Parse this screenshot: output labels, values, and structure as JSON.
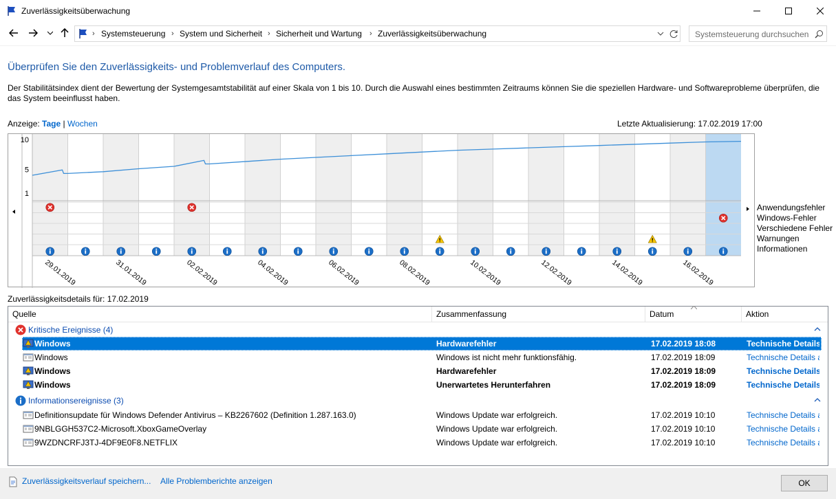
{
  "window": {
    "title": "Zuverlässigkeitsüberwachung"
  },
  "address": {
    "crumbs": [
      "Systemsteuerung",
      "System und Sicherheit",
      "Sicherheit und Wartung",
      "Zuverlässigkeitsüberwachung"
    ],
    "search_placeholder": "Systemsteuerung durchsuchen"
  },
  "page": {
    "heading": "Überprüfen Sie den Zuverlässigkeits- und Problemverlauf des Computers.",
    "description": "Der Stabilitätsindex dient der Bewertung der Systemgesamtstabilität auf einer Skala von 1 bis 10. Durch die Auswahl eines bestimmten Zeitraums können Sie die speziellen Hardware- und Softwareprobleme überprüfen, die das System beeinflusst haben.",
    "view_label": "Anzeige:",
    "view_days": "Tage",
    "view_sep": "|",
    "view_weeks": "Wochen",
    "last_update": "Letzte Aktualisierung: 17.02.2019 17:00"
  },
  "chart": {
    "y_ticks": [
      "10",
      "5",
      "1"
    ],
    "legend": [
      "Anwendungsfehler",
      "Windows-Fehler",
      "Verschiedene Fehler",
      "Warnungen",
      "Informationen"
    ],
    "dates": [
      "29.01.2019",
      "31.01.2019",
      "02.02.2019",
      "04.02.2019",
      "06.02.2019",
      "08.02.2019",
      "10.02.2019",
      "12.02.2019",
      "14.02.2019",
      "16.02.2019"
    ],
    "selected_day": "17.02.2019"
  },
  "chart_data": {
    "type": "line",
    "x": [
      "29.01.2019",
      "30.01.2019",
      "31.01.2019",
      "01.02.2019",
      "02.02.2019",
      "03.02.2019",
      "04.02.2019",
      "05.02.2019",
      "06.02.2019",
      "07.02.2019",
      "08.02.2019",
      "09.02.2019",
      "10.02.2019",
      "11.02.2019",
      "12.02.2019",
      "13.02.2019",
      "14.02.2019",
      "15.02.2019",
      "16.02.2019",
      "17.02.2019"
    ],
    "stability_index": [
      4.0,
      4.3,
      4.6,
      5.1,
      5.5,
      5.9,
      6.3,
      6.7,
      7.0,
      7.3,
      7.6,
      7.9,
      8.2,
      8.4,
      8.6,
      8.8,
      9.0,
      9.2,
      9.4,
      9.6
    ],
    "y_ticks": [
      10,
      5,
      1
    ],
    "events": {
      "Anwendungsfehler": [
        "29.01.2019",
        "02.02.2019"
      ],
      "Windows-Fehler": [
        "17.02.2019"
      ],
      "Verschiedene Fehler": [],
      "Warnungen": [
        "09.02.2019",
        "15.02.2019"
      ],
      "Informationen": [
        "29.01.2019",
        "30.01.2019",
        "31.01.2019",
        "01.02.2019",
        "02.02.2019",
        "03.02.2019",
        "04.02.2019",
        "05.02.2019",
        "06.02.2019",
        "07.02.2019",
        "08.02.2019",
        "09.02.2019",
        "10.02.2019",
        "11.02.2019",
        "12.02.2019",
        "13.02.2019",
        "14.02.2019",
        "15.02.2019",
        "16.02.2019",
        "17.02.2019"
      ]
    },
    "selected": "17.02.2019"
  },
  "details": {
    "label": "Zuverlässigkeitsdetails für: 17.02.2019",
    "columns": [
      "Quelle",
      "Zusammenfassung",
      "Datum",
      "Aktion"
    ],
    "groups": [
      {
        "label": "Kritische Ereignisse (4)",
        "rows": [
          {
            "source": "Windows",
            "summary": "Hardwarefehler",
            "date": "17.02.2019 18:08",
            "action": "Technische Details anzeigen"
          },
          {
            "source": "Windows",
            "summary": "Windows ist nicht mehr funktionsfähig.",
            "date": "17.02.2019 18:09",
            "action": "Technische Details anzeigen"
          },
          {
            "source": "Windows",
            "summary": "Hardwarefehler",
            "date": "17.02.2019 18:09",
            "action": "Technische Details anzeigen"
          },
          {
            "source": "Windows",
            "summary": "Unerwartetes Herunterfahren",
            "date": "17.02.2019 18:09",
            "action": "Technische Details anzeigen"
          }
        ]
      },
      {
        "label": "Informationsereignisse (3)",
        "rows": [
          {
            "source": "Definitionsupdate für Windows Defender Antivirus – KB2267602 (Definition 1.287.163.0)",
            "summary": "Windows Update war erfolgreich.",
            "date": "17.02.2019 10:10",
            "action": "Technische Details anzeigen"
          },
          {
            "source": "9NBLGGH537C2-Microsoft.XboxGameOverlay",
            "summary": "Windows Update war erfolgreich.",
            "date": "17.02.2019 10:10",
            "action": "Technische Details anzeigen"
          },
          {
            "source": "9WZDNCRFJ3TJ-4DF9E0F8.NETFLIX",
            "summary": "Windows Update war erfolgreich.",
            "date": "17.02.2019 10:10",
            "action": "Technische Details anzeigen"
          }
        ]
      }
    ]
  },
  "footer": {
    "save_link": "Zuverlässigkeitsverlauf speichern...",
    "reports_link": "Alle Problemberichte anzeigen",
    "ok": "OK"
  }
}
